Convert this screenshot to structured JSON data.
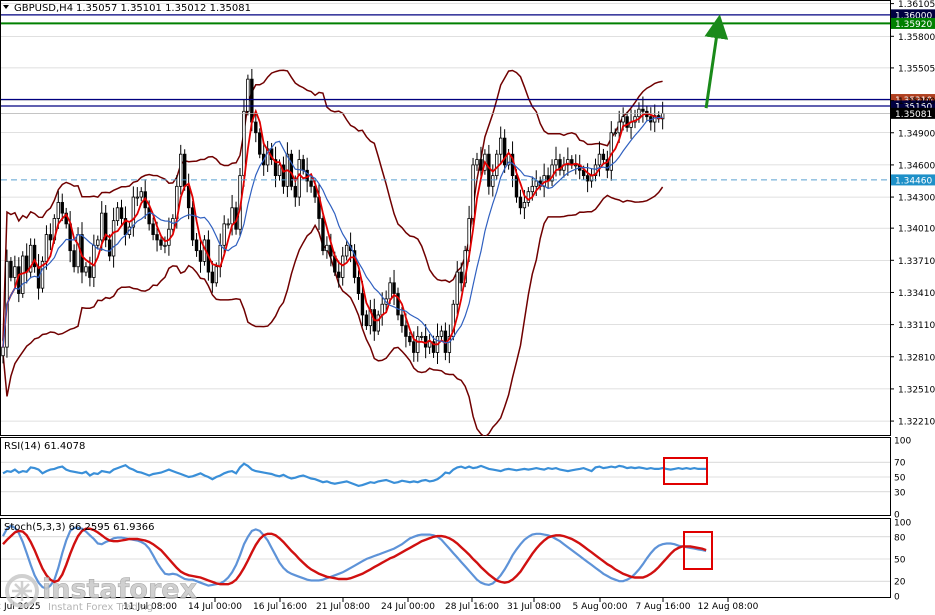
{
  "header": {
    "symbol": "GBPUSD,H4",
    "ohlc": "1.35057 1.35101 1.35012 1.35081"
  },
  "colors": {
    "bg": "#ffffff",
    "border": "#000000",
    "grid": "#c0c0c0",
    "candle": "#000000",
    "fast_ma": "#e00000",
    "slow_ma": "#3060c0",
    "bollinger": "#700000",
    "level_top": "#000080",
    "level_green": "#008000",
    "level_dash": "#5aa0d0",
    "arrow": "#1a8a1a",
    "tag_dark": "#000040",
    "tag_green": "#008000",
    "tag_red": "#b04020",
    "tag_last": "#000000",
    "tag_dash": "#1e90c8",
    "rsi_line": "#3a8fd8",
    "stoch_main": "#5e93d8",
    "stoch_signal": "#d01010",
    "highlight_box": "#e00000"
  },
  "chart_data": [
    {
      "type": "candlestick",
      "title": "GBPUSD,H4",
      "ylim": [
        1.3208,
        1.3612
      ],
      "y_ticks": [
        "1.36105",
        "1.35800",
        "1.35505",
        "1.35200",
        "1.34900",
        "1.34600",
        "1.34300",
        "1.34010",
        "1.33710",
        "1.33410",
        "1.33110",
        "1.32810",
        "1.32510",
        "1.32210"
      ],
      "x_ticks": [
        "14 Jul 00:00",
        "16 Jul 16:00",
        "21 Jul 08:00",
        "24 Jul 00:00",
        "28 Jul 16:00",
        "31 Jul 08:00",
        "5 Aug 00:00",
        "7 Aug 16:00",
        "12 Aug 08:00"
      ],
      "x_ticks_partial": [
        "2 Jul 2025",
        "11 Jul 08:00"
      ],
      "path_close": [
        1.329,
        1.337,
        1.3355,
        1.3365,
        1.334,
        1.3375,
        1.336,
        1.3385,
        1.3365,
        1.3345,
        1.337,
        1.3395,
        1.339,
        1.341,
        1.3425,
        1.3415,
        1.3405,
        1.338,
        1.3365,
        1.3395,
        1.336,
        1.3365,
        1.3355,
        1.3385,
        1.339,
        1.3415,
        1.339,
        1.3375,
        1.3408,
        1.342,
        1.341,
        1.3395,
        1.3402,
        1.343,
        1.343,
        1.3435,
        1.342,
        1.3405,
        1.3395,
        1.339,
        1.3385,
        1.3385,
        1.34,
        1.341,
        1.344,
        1.347,
        1.344,
        1.342,
        1.339,
        1.338,
        1.337,
        1.339,
        1.336,
        1.335,
        1.3365,
        1.3385,
        1.3405,
        1.3405,
        1.342,
        1.34,
        1.345,
        1.351,
        1.354,
        1.35,
        1.349,
        1.347,
        1.346,
        1.3475,
        1.3465,
        1.345,
        1.346,
        1.344,
        1.347,
        1.344,
        1.343,
        1.3465,
        1.3455,
        1.3445,
        1.344,
        1.343,
        1.341,
        1.338,
        1.3385,
        1.3375,
        1.336,
        1.3355,
        1.3375,
        1.3385,
        1.338,
        1.3355,
        1.334,
        1.332,
        1.331,
        1.3325,
        1.3305,
        1.332,
        1.333,
        1.3335,
        1.335,
        1.334,
        1.332,
        1.331,
        1.33,
        1.3295,
        1.3285,
        1.33,
        1.33,
        1.329,
        1.3295,
        1.3285,
        1.33,
        1.3305,
        1.3285,
        1.33,
        1.333,
        1.336,
        1.335,
        1.338,
        1.341,
        1.346,
        1.3465,
        1.3455,
        1.347,
        1.344,
        1.345,
        1.347,
        1.3485,
        1.346,
        1.347,
        1.345,
        1.343,
        1.342,
        1.3425,
        1.3435,
        1.344,
        1.3445,
        1.344,
        1.345,
        1.3445,
        1.346,
        1.3465,
        1.3455,
        1.346,
        1.3465,
        1.346,
        1.346,
        1.3455,
        1.345,
        1.3445,
        1.345,
        1.346,
        1.347,
        1.3465,
        1.3455,
        1.349,
        1.349,
        1.35,
        1.3505,
        1.3495,
        1.35,
        1.3505,
        1.3512,
        1.351,
        1.3505,
        1.35,
        1.3506,
        1.3503,
        1.3508
      ],
      "levels": [
        {
          "label": "1.36000",
          "value": 1.36,
          "style": "solid"
        },
        {
          "label": "1.35920",
          "value": 1.3592,
          "style": "solid"
        },
        {
          "label": "1.35210",
          "value": 1.3521,
          "style": "solid"
        },
        {
          "label": "1.35150",
          "value": 1.3515,
          "style": "solid"
        },
        {
          "label": "1.35081",
          "value": 1.35081,
          "style": "last"
        },
        {
          "label": "1.34460",
          "value": 1.3446,
          "style": "dashed"
        }
      ],
      "arrow": {
        "from_bar": 178,
        "from_price": 1.3513,
        "to_price": 1.3595
      },
      "indicators": [
        "moving average (fast)",
        "moving average (slow)",
        "Bollinger Bands"
      ]
    },
    {
      "type": "line",
      "title": "RSI(14) 61.4078",
      "ylim": [
        0,
        100
      ],
      "y_ticks": [
        "100",
        "70",
        "50",
        "30",
        "0"
      ],
      "values": [
        55,
        58,
        57,
        60,
        56,
        58,
        57,
        63,
        62,
        60,
        55,
        58,
        60,
        61,
        63,
        64,
        60,
        58,
        57,
        56,
        55,
        57,
        52,
        55,
        54,
        58,
        57,
        56,
        60,
        62,
        64,
        66,
        62,
        60,
        57,
        56,
        54,
        52,
        54,
        55,
        56,
        58,
        60,
        58,
        56,
        54,
        52,
        50,
        51,
        53,
        55,
        52,
        50,
        47,
        50,
        52,
        55,
        57,
        58,
        55,
        63,
        68,
        65,
        60,
        58,
        57,
        56,
        55,
        54,
        52,
        51,
        53,
        50,
        48,
        49,
        51,
        52,
        50,
        48,
        47,
        45,
        43,
        44,
        42,
        41,
        42,
        43,
        44,
        42,
        40,
        38,
        39,
        41,
        43,
        42,
        44,
        45,
        46,
        44,
        42,
        43,
        45,
        44,
        43,
        44,
        43,
        45,
        46,
        44,
        45,
        47,
        51,
        56,
        55,
        60,
        63,
        64,
        62,
        64,
        62,
        63,
        65,
        63,
        61,
        60,
        59,
        58,
        60,
        61,
        60,
        59,
        60,
        61,
        60,
        61,
        62,
        61,
        60,
        62,
        61,
        62,
        60,
        59,
        58,
        59,
        60,
        61,
        62,
        60,
        58,
        63,
        64,
        62,
        63,
        64,
        63,
        65,
        64,
        62,
        63,
        62,
        63,
        62,
        61,
        62,
        61,
        61,
        62,
        61,
        60,
        61,
        62,
        61,
        62,
        61,
        62,
        61,
        61,
        61
      ]
    },
    {
      "type": "line",
      "title": "Stoch(5,3,3) 66.2595 61.9366",
      "ylim": [
        0,
        100
      ],
      "y_ticks": [
        "100",
        "80",
        "50",
        "20",
        "0"
      ],
      "series": [
        {
          "values": [
            81,
            91,
            95,
            92,
            85,
            73,
            58,
            42,
            28,
            18,
            12,
            10,
            14,
            22,
            38,
            58,
            75,
            88,
            92,
            92,
            91,
            87,
            82,
            77,
            71,
            70,
            73,
            75,
            78,
            79,
            79,
            78,
            77,
            76,
            75,
            73,
            70,
            64,
            55,
            45,
            37,
            30,
            29,
            30,
            29,
            26,
            23,
            22,
            22,
            20,
            18,
            16,
            14,
            15,
            16,
            17,
            20,
            25,
            32,
            42,
            55,
            70,
            80,
            88,
            90,
            88,
            82,
            75,
            65,
            55,
            45,
            38,
            33,
            30,
            28,
            26,
            24,
            22,
            21,
            21,
            21,
            22,
            24,
            26,
            28,
            30,
            32,
            35,
            38,
            41,
            44,
            47,
            50,
            52,
            54,
            56,
            58,
            60,
            62,
            64,
            67,
            70,
            74,
            78,
            80,
            82,
            83,
            83,
            83,
            82,
            80,
            76,
            70,
            64,
            58,
            52,
            46,
            40,
            34,
            28,
            22,
            18,
            16,
            15,
            17,
            22,
            28,
            36,
            45,
            55,
            63,
            70,
            76,
            80,
            83,
            84,
            84,
            83,
            82,
            80,
            77,
            74,
            70,
            66,
            62,
            58,
            54,
            50,
            46,
            42,
            38,
            34,
            30,
            27,
            24,
            22,
            20,
            20,
            22,
            25,
            30,
            36,
            43,
            51,
            58,
            64,
            68,
            70,
            71,
            71,
            70,
            68,
            67,
            66,
            65,
            64,
            63,
            62,
            61
          ]
        },
        {
          "values": [
            70,
            76,
            81,
            86,
            88,
            87,
            82,
            73,
            62,
            49,
            37,
            28,
            22,
            19,
            21,
            29,
            42,
            57,
            70,
            81,
            88,
            91,
            91,
            89,
            86,
            82,
            78,
            75,
            74,
            74,
            75,
            76,
            77,
            77,
            77,
            76,
            75,
            73,
            70,
            66,
            62,
            56,
            50,
            44,
            38,
            33,
            30,
            28,
            27,
            26,
            25,
            23,
            21,
            19,
            17,
            16,
            16,
            16,
            18,
            22,
            29,
            38,
            48,
            59,
            69,
            77,
            82,
            84,
            84,
            82,
            78,
            73,
            67,
            61,
            56,
            50,
            45,
            40,
            36,
            33,
            30,
            28,
            26,
            25,
            24,
            23,
            23,
            23,
            24,
            26,
            28,
            30,
            33,
            36,
            39,
            42,
            45,
            48,
            51,
            53,
            56,
            59,
            62,
            65,
            68,
            71,
            74,
            76,
            78,
            80,
            81,
            81,
            80,
            78,
            75,
            71,
            66,
            61,
            56,
            50,
            45,
            39,
            34,
            29,
            25,
            21,
            19,
            18,
            19,
            22,
            27,
            33,
            41,
            49,
            57,
            64,
            70,
            75,
            79,
            81,
            82,
            82,
            81,
            79,
            77,
            74,
            71,
            67,
            63,
            59,
            55,
            51,
            47,
            43,
            40,
            36,
            33,
            30,
            28,
            26,
            25,
            25,
            25,
            27,
            30,
            34,
            39,
            45,
            51,
            57,
            62,
            65,
            67,
            67,
            67,
            66,
            65,
            64,
            62
          ]
        }
      ]
    }
  ],
  "watermark": {
    "brand": "instaforex",
    "tagline": "Instant Forex Trading"
  }
}
